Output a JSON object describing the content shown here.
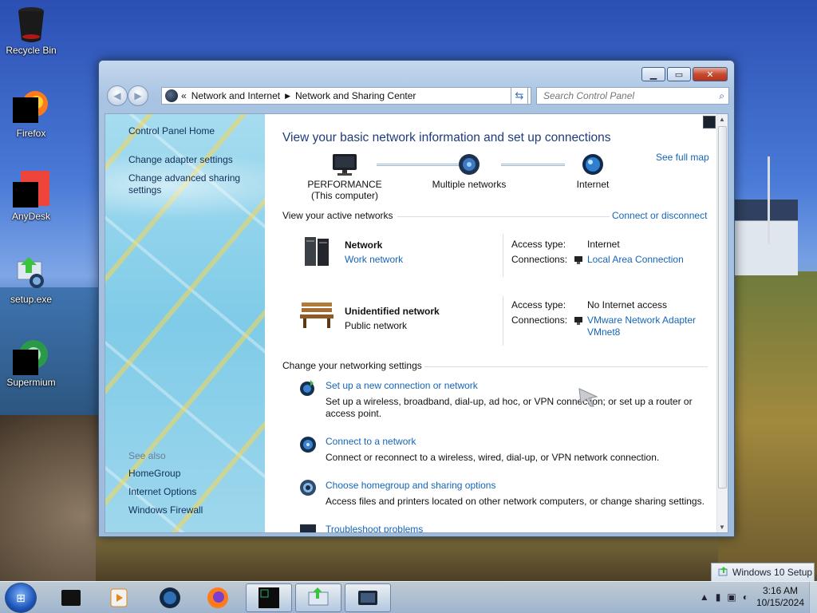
{
  "desktop": {
    "icons": [
      {
        "label": "Recycle Bin",
        "icon": "recycle-bin-icon"
      },
      {
        "label": "Firefox",
        "icon": "firefox-icon"
      },
      {
        "label": "AnyDesk",
        "icon": "anydesk-icon"
      },
      {
        "label": "setup.exe",
        "icon": "setup-exe-icon"
      },
      {
        "label": "Supermium",
        "icon": "supermium-icon"
      }
    ]
  },
  "window": {
    "buttons": {
      "minimize": "▁",
      "maximize": "▭",
      "close": "✕"
    },
    "address": {
      "chevron": "«",
      "seg1": "Network and Internet",
      "seg2": "Network and Sharing Center"
    },
    "search_placeholder": "Search Control Panel"
  },
  "sidebar": {
    "home": "Control Panel Home",
    "links": [
      "Change adapter settings",
      "Change advanced sharing settings"
    ],
    "see_also_label": "See also",
    "see_also": [
      "HomeGroup",
      "Internet Options",
      "Windows Firewall"
    ]
  },
  "main": {
    "title": "View your basic network information and set up connections",
    "see_full_map": "See full map",
    "map": {
      "computer": "PERFORMANCE",
      "computer_sub": "(This computer)",
      "middle": "Multiple networks",
      "internet": "Internet"
    },
    "active_header": "View your active networks",
    "connect_disconnect": "Connect or disconnect",
    "networks": [
      {
        "name": "Network",
        "type": "Work network",
        "access_label": "Access type:",
        "access": "Internet",
        "conn_label": "Connections:",
        "conn": "Local Area Connection"
      },
      {
        "name": "Unidentified network",
        "type": "Public network",
        "access_label": "Access type:",
        "access": "No Internet access",
        "conn_label": "Connections:",
        "conn_line1": "VMware Network Adapter",
        "conn_line2": "VMnet8"
      }
    ],
    "settings_header": "Change your networking settings",
    "tasks": [
      {
        "title": "Set up a new connection or network",
        "desc1": "Set up a wireless, broadband, dial-up, ad hoc, or VPN connection; or set up a router or",
        "desc2": "access point."
      },
      {
        "title": "Connect to a network",
        "desc1": "Connect or reconnect to a wireless, wired, dial-up, or VPN network connection."
      },
      {
        "title": "Choose homegroup and sharing options",
        "desc1": "Access files and printers located on other network computers, or change sharing settings."
      },
      {
        "title": "Troubleshoot problems"
      }
    ]
  },
  "taskbar": {
    "toast": "Windows 10 Setup",
    "time": "3:16 AM",
    "date": "10/15/2024"
  }
}
